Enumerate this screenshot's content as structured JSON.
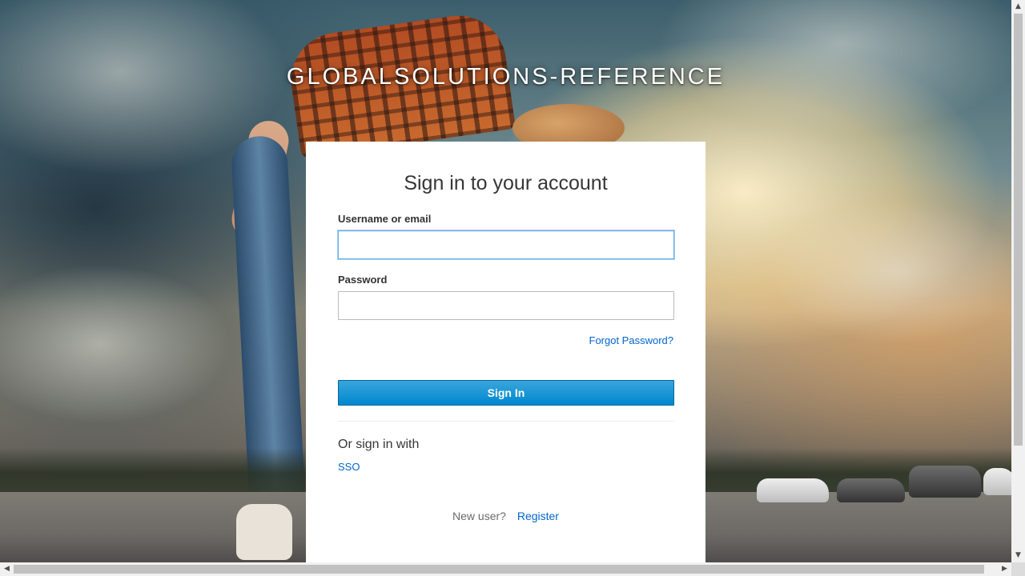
{
  "realm": {
    "title": "GLOBALSOLUTIONS-REFERENCE"
  },
  "login": {
    "heading": "Sign in to your account",
    "username_label": "Username or email",
    "username_value": "",
    "password_label": "Password",
    "password_value": "",
    "forgot_password": "Forgot Password?",
    "sign_in_button": "Sign In"
  },
  "social": {
    "title": "Or sign in with",
    "providers": [
      "SSO"
    ]
  },
  "registration": {
    "prompt": "New user?",
    "link": "Register"
  },
  "scrollbars": {
    "up_arrow": "▲",
    "down_arrow": "▼",
    "left_arrow": "◀",
    "right_arrow": "▶"
  },
  "colors": {
    "accent": "#0088ce",
    "link": "#0066cc",
    "focus_ring": "#66afe9"
  }
}
